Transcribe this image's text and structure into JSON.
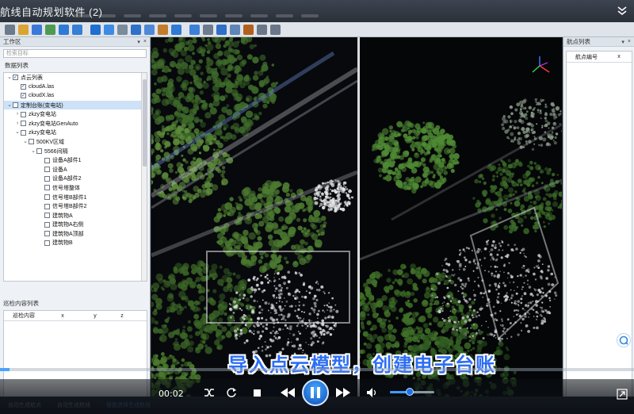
{
  "window": {
    "title": "航线自动规划软件 (2)"
  },
  "workspace": {
    "title": "工作区",
    "search_placeholder": "检索目标",
    "data_list_label": "数据列表",
    "tree": [
      {
        "label": "点云列表",
        "level": 0,
        "expanded": true,
        "checked": true
      },
      {
        "label": "cloudA.las",
        "level": 1,
        "checked": true
      },
      {
        "label": "cloudX.las",
        "level": 1,
        "checked": true
      },
      {
        "label": "定制台账(变电站)",
        "level": 0,
        "expanded": true,
        "checked": false,
        "selected": true
      },
      {
        "label": "zkzy变电站",
        "level": 1,
        "expandable": true,
        "checked": false
      },
      {
        "label": "zkzy变电站GenAuto",
        "level": 1,
        "expandable": true,
        "checked": false
      },
      {
        "label": "zkzy变电站",
        "level": 1,
        "expanded": true,
        "checked": false
      },
      {
        "label": "500KV区域",
        "level": 2,
        "expanded": true,
        "checked": false
      },
      {
        "label": "5566间隔",
        "level": 3,
        "expanded": true,
        "checked": false
      },
      {
        "label": "设备A部件1",
        "level": 4,
        "checked": false
      },
      {
        "label": "设备A",
        "level": 4,
        "checked": false
      },
      {
        "label": "设备A部件2",
        "level": 4,
        "checked": false
      },
      {
        "label": "信号塔整体",
        "level": 4,
        "checked": false
      },
      {
        "label": "信号塔B部件1",
        "level": 4,
        "checked": false
      },
      {
        "label": "信号塔B部件2",
        "level": 4,
        "checked": false
      },
      {
        "label": "建筑物A",
        "level": 4,
        "checked": false
      },
      {
        "label": "建筑物A右侧",
        "level": 4,
        "checked": false
      },
      {
        "label": "建筑物A顶部",
        "level": 4,
        "checked": false
      },
      {
        "label": "建筑物B",
        "level": 4,
        "checked": false
      }
    ]
  },
  "inspection": {
    "title": "巡检内容列表",
    "columns": [
      "巡检内容",
      "x",
      "y",
      "z"
    ]
  },
  "waypoints": {
    "title": "航点列表",
    "columns": [
      "航点编号",
      "x"
    ]
  },
  "subtitle": "导入点云模型，创建电子台账",
  "player": {
    "time": "00:02",
    "progress": 0.015,
    "volume": 0.45
  },
  "bottom_tabs": [
    "自动生成航点",
    "自动生成航线",
    "智能选择生成航线"
  ],
  "icons": {
    "toolbar": [
      "new-file-icon",
      "open-icon",
      "save-icon",
      "layers-icon",
      "point-cloud-icon",
      "select-icon",
      "measure-icon",
      "grid-icon",
      "tower-icon",
      "route-icon",
      "waypoint-icon",
      "photo-icon",
      "globe-icon",
      "split-icon",
      "settings-icon",
      "export-icon",
      "import-icon",
      "report-icon",
      "camera-icon",
      "upload-icon"
    ],
    "colors": {
      "accent": "#2d6ef5",
      "progress": "#4aa3ff",
      "panel": "#eef1f5"
    }
  }
}
